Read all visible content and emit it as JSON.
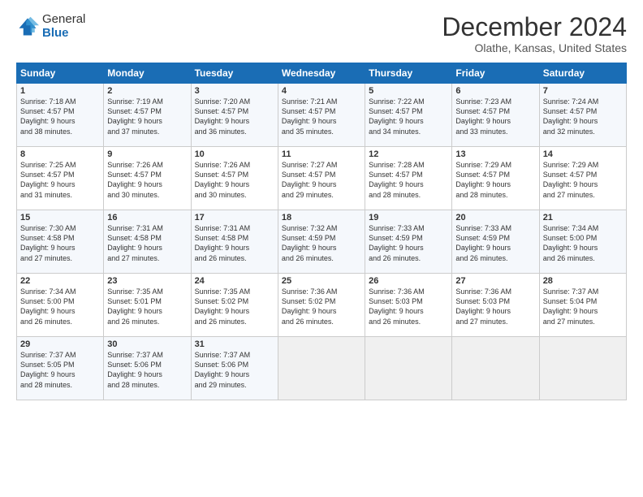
{
  "header": {
    "logo_line1": "General",
    "logo_line2": "Blue",
    "month_year": "December 2024",
    "location": "Olathe, Kansas, United States"
  },
  "weekdays": [
    "Sunday",
    "Monday",
    "Tuesday",
    "Wednesday",
    "Thursday",
    "Friday",
    "Saturday"
  ],
  "weeks": [
    [
      {
        "day": "1",
        "sunrise": "7:18 AM",
        "sunset": "4:57 PM",
        "daylight": "9 hours and 38 minutes."
      },
      {
        "day": "2",
        "sunrise": "7:19 AM",
        "sunset": "4:57 PM",
        "daylight": "9 hours and 37 minutes."
      },
      {
        "day": "3",
        "sunrise": "7:20 AM",
        "sunset": "4:57 PM",
        "daylight": "9 hours and 36 minutes."
      },
      {
        "day": "4",
        "sunrise": "7:21 AM",
        "sunset": "4:57 PM",
        "daylight": "9 hours and 35 minutes."
      },
      {
        "day": "5",
        "sunrise": "7:22 AM",
        "sunset": "4:57 PM",
        "daylight": "9 hours and 34 minutes."
      },
      {
        "day": "6",
        "sunrise": "7:23 AM",
        "sunset": "4:57 PM",
        "daylight": "9 hours and 33 minutes."
      },
      {
        "day": "7",
        "sunrise": "7:24 AM",
        "sunset": "4:57 PM",
        "daylight": "9 hours and 32 minutes."
      }
    ],
    [
      {
        "day": "8",
        "sunrise": "7:25 AM",
        "sunset": "4:57 PM",
        "daylight": "9 hours and 31 minutes."
      },
      {
        "day": "9",
        "sunrise": "7:26 AM",
        "sunset": "4:57 PM",
        "daylight": "9 hours and 30 minutes."
      },
      {
        "day": "10",
        "sunrise": "7:26 AM",
        "sunset": "4:57 PM",
        "daylight": "9 hours and 30 minutes."
      },
      {
        "day": "11",
        "sunrise": "7:27 AM",
        "sunset": "4:57 PM",
        "daylight": "9 hours and 29 minutes."
      },
      {
        "day": "12",
        "sunrise": "7:28 AM",
        "sunset": "4:57 PM",
        "daylight": "9 hours and 28 minutes."
      },
      {
        "day": "13",
        "sunrise": "7:29 AM",
        "sunset": "4:57 PM",
        "daylight": "9 hours and 28 minutes."
      },
      {
        "day": "14",
        "sunrise": "7:29 AM",
        "sunset": "4:57 PM",
        "daylight": "9 hours and 27 minutes."
      }
    ],
    [
      {
        "day": "15",
        "sunrise": "7:30 AM",
        "sunset": "4:58 PM",
        "daylight": "9 hours and 27 minutes."
      },
      {
        "day": "16",
        "sunrise": "7:31 AM",
        "sunset": "4:58 PM",
        "daylight": "9 hours and 27 minutes."
      },
      {
        "day": "17",
        "sunrise": "7:31 AM",
        "sunset": "4:58 PM",
        "daylight": "9 hours and 26 minutes."
      },
      {
        "day": "18",
        "sunrise": "7:32 AM",
        "sunset": "4:59 PM",
        "daylight": "9 hours and 26 minutes."
      },
      {
        "day": "19",
        "sunrise": "7:33 AM",
        "sunset": "4:59 PM",
        "daylight": "9 hours and 26 minutes."
      },
      {
        "day": "20",
        "sunrise": "7:33 AM",
        "sunset": "4:59 PM",
        "daylight": "9 hours and 26 minutes."
      },
      {
        "day": "21",
        "sunrise": "7:34 AM",
        "sunset": "5:00 PM",
        "daylight": "9 hours and 26 minutes."
      }
    ],
    [
      {
        "day": "22",
        "sunrise": "7:34 AM",
        "sunset": "5:00 PM",
        "daylight": "9 hours and 26 minutes."
      },
      {
        "day": "23",
        "sunrise": "7:35 AM",
        "sunset": "5:01 PM",
        "daylight": "9 hours and 26 minutes."
      },
      {
        "day": "24",
        "sunrise": "7:35 AM",
        "sunset": "5:02 PM",
        "daylight": "9 hours and 26 minutes."
      },
      {
        "day": "25",
        "sunrise": "7:36 AM",
        "sunset": "5:02 PM",
        "daylight": "9 hours and 26 minutes."
      },
      {
        "day": "26",
        "sunrise": "7:36 AM",
        "sunset": "5:03 PM",
        "daylight": "9 hours and 26 minutes."
      },
      {
        "day": "27",
        "sunrise": "7:36 AM",
        "sunset": "5:03 PM",
        "daylight": "9 hours and 27 minutes."
      },
      {
        "day": "28",
        "sunrise": "7:37 AM",
        "sunset": "5:04 PM",
        "daylight": "9 hours and 27 minutes."
      }
    ],
    [
      {
        "day": "29",
        "sunrise": "7:37 AM",
        "sunset": "5:05 PM",
        "daylight": "9 hours and 28 minutes."
      },
      {
        "day": "30",
        "sunrise": "7:37 AM",
        "sunset": "5:06 PM",
        "daylight": "9 hours and 28 minutes."
      },
      {
        "day": "31",
        "sunrise": "7:37 AM",
        "sunset": "5:06 PM",
        "daylight": "9 hours and 29 minutes."
      },
      null,
      null,
      null,
      null
    ]
  ],
  "labels": {
    "sunrise": "Sunrise:",
    "sunset": "Sunset:",
    "daylight": "Daylight: "
  }
}
